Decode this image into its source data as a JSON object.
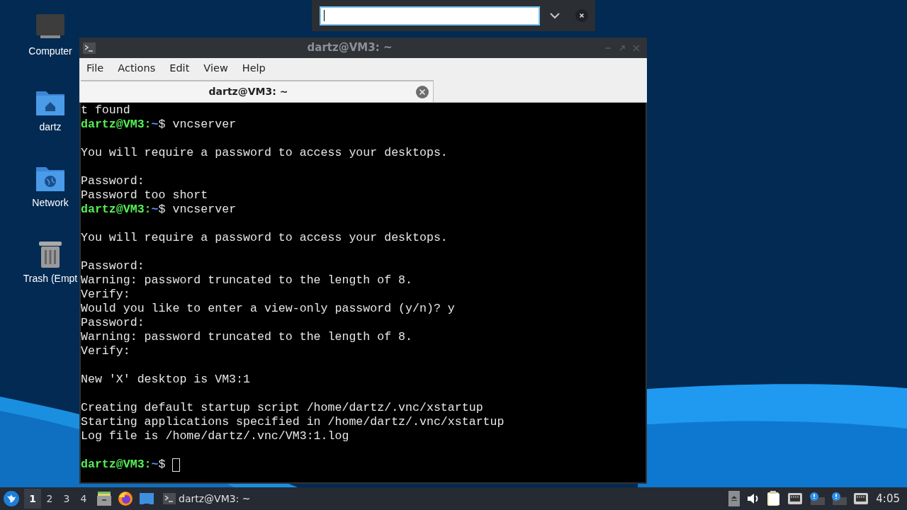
{
  "desktop_icons": [
    {
      "kind": "computer",
      "label": "Computer"
    },
    {
      "kind": "home",
      "label": "dartz"
    },
    {
      "kind": "network",
      "label": "Network"
    },
    {
      "kind": "trash",
      "label": "Trash (Empt"
    }
  ],
  "window": {
    "title": "dartz@VM3: ~",
    "active": false
  },
  "menu": [
    "File",
    "Actions",
    "Edit",
    "View",
    "Help"
  ],
  "tabs": [
    {
      "label": "dartz@VM3: ~",
      "selected": true
    }
  ],
  "terminal_lines": [
    {
      "kind": "output",
      "text": "t found"
    },
    {
      "kind": "prompt",
      "user_host": "dartz@VM3:",
      "path": "~",
      "command": "$ vncserver"
    },
    {
      "kind": "blank"
    },
    {
      "kind": "output",
      "text": "You will require a password to access your desktops."
    },
    {
      "kind": "blank"
    },
    {
      "kind": "output",
      "text": "Password:"
    },
    {
      "kind": "output",
      "text": "Password too short"
    },
    {
      "kind": "prompt",
      "user_host": "dartz@VM3:",
      "path": "~",
      "command": "$ vncserver"
    },
    {
      "kind": "blank"
    },
    {
      "kind": "output",
      "text": "You will require a password to access your desktops."
    },
    {
      "kind": "blank"
    },
    {
      "kind": "output",
      "text": "Password:"
    },
    {
      "kind": "output",
      "text": "Warning: password truncated to the length of 8."
    },
    {
      "kind": "output",
      "text": "Verify:"
    },
    {
      "kind": "output",
      "text": "Would you like to enter a view-only password (y/n)? y"
    },
    {
      "kind": "output",
      "text": "Password:"
    },
    {
      "kind": "output",
      "text": "Warning: password truncated to the length of 8."
    },
    {
      "kind": "output",
      "text": "Verify:"
    },
    {
      "kind": "blank"
    },
    {
      "kind": "output",
      "text": "New 'X' desktop is VM3:1"
    },
    {
      "kind": "blank"
    },
    {
      "kind": "output",
      "text": "Creating default startup script /home/dartz/.vnc/xstartup"
    },
    {
      "kind": "output",
      "text": "Starting applications specified in /home/dartz/.vnc/xstartup"
    },
    {
      "kind": "output",
      "text": "Log file is /home/dartz/.vnc/VM3:1.log"
    },
    {
      "kind": "blank"
    },
    {
      "kind": "prompt",
      "user_host": "dartz@VM3:",
      "path": "~",
      "command": "$ ",
      "cursor": true
    }
  ],
  "taskbar": {
    "workspaces": [
      {
        "label": "1",
        "selected": true
      },
      {
        "label": "2",
        "selected": false
      },
      {
        "label": "3",
        "selected": false
      },
      {
        "label": "4",
        "selected": false
      }
    ],
    "tasks": [
      {
        "label": "dartz@VM3: ~"
      }
    ],
    "clock": "4:05"
  }
}
